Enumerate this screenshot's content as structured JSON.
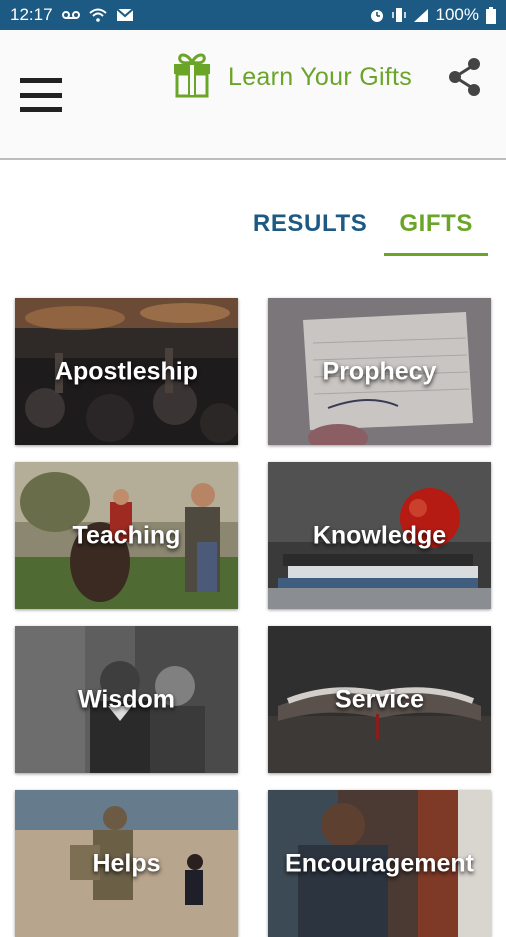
{
  "status_bar": {
    "time": "12:17",
    "battery": "100%"
  },
  "app": {
    "title": "Learn Your Gifts",
    "brand_color": "#6aa528",
    "primary_color": "#1c5a84"
  },
  "tabs": [
    {
      "label": "RESULTS",
      "active": false
    },
    {
      "label": "GIFTS",
      "active": true
    }
  ],
  "gifts": [
    {
      "label": "Apostleship",
      "image": "worship-crowd"
    },
    {
      "label": "Prophecy",
      "image": "handwritten-note"
    },
    {
      "label": "Teaching",
      "image": "horse-ranch"
    },
    {
      "label": "Knowledge",
      "image": "apple-on-books"
    },
    {
      "label": "Wisdom",
      "image": "elderly-men-portrait"
    },
    {
      "label": "Service",
      "image": "open-bible"
    },
    {
      "label": "Helps",
      "image": "soldier-with-child"
    },
    {
      "label": "Encouragement",
      "image": "man-by-brick-wall"
    }
  ]
}
